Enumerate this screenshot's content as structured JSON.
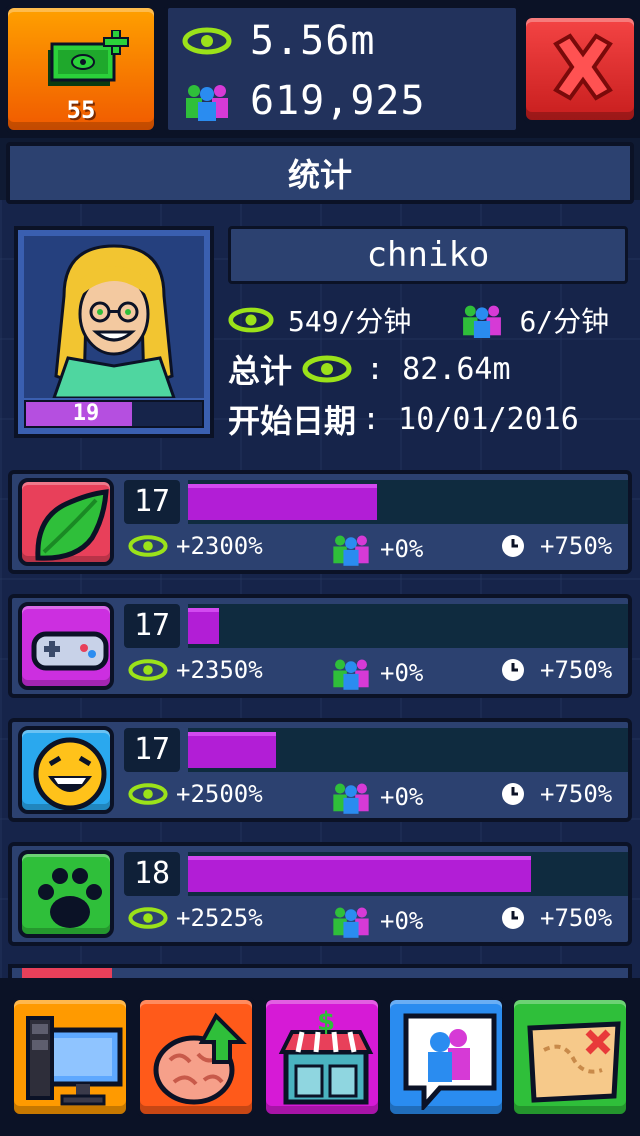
{
  "header": {
    "cash_count": "55",
    "views_total": "5.56m",
    "followers_total": "619,925"
  },
  "title": "统计",
  "profile": {
    "name": "chniko",
    "level": "19",
    "level_progress": 0.6,
    "views_rate": "549/分钟",
    "followers_rate": "6/分钟",
    "total_label": "总计",
    "total_value": ": 82.64m",
    "start_label": "开始日期",
    "start_value": ": 10/01/2016"
  },
  "categories": [
    {
      "icon": "leaf-icon",
      "color": "#e8405a",
      "level": "17",
      "progress": 0.43,
      "views_bonus": "+2300%",
      "followers_bonus": "+0%",
      "time_bonus": "+750%"
    },
    {
      "icon": "gamepad-icon",
      "color": "#cc2fe0",
      "level": "17",
      "progress": 0.07,
      "views_bonus": "+2350%",
      "followers_bonus": "+0%",
      "time_bonus": "+750%"
    },
    {
      "icon": "laughing-face-icon",
      "color": "#2aa8ee",
      "level": "17",
      "progress": 0.2,
      "views_bonus": "+2500%",
      "followers_bonus": "+0%",
      "time_bonus": "+750%"
    },
    {
      "icon": "paw-icon",
      "color": "#2fbf3a",
      "level": "18",
      "progress": 0.78,
      "views_bonus": "+2525%",
      "followers_bonus": "+0%",
      "time_bonus": "+750%"
    }
  ],
  "nav": [
    {
      "icon": "streaming-setup-icon",
      "color": "#ff9a00"
    },
    {
      "icon": "brain-upgrade-icon",
      "color": "#ff5a1a"
    },
    {
      "icon": "shop-icon",
      "color": "#d61ad6"
    },
    {
      "icon": "chat-people-icon",
      "color": "#2a8cf0"
    },
    {
      "icon": "map-icon",
      "color": "#2fbf3a"
    }
  ]
}
